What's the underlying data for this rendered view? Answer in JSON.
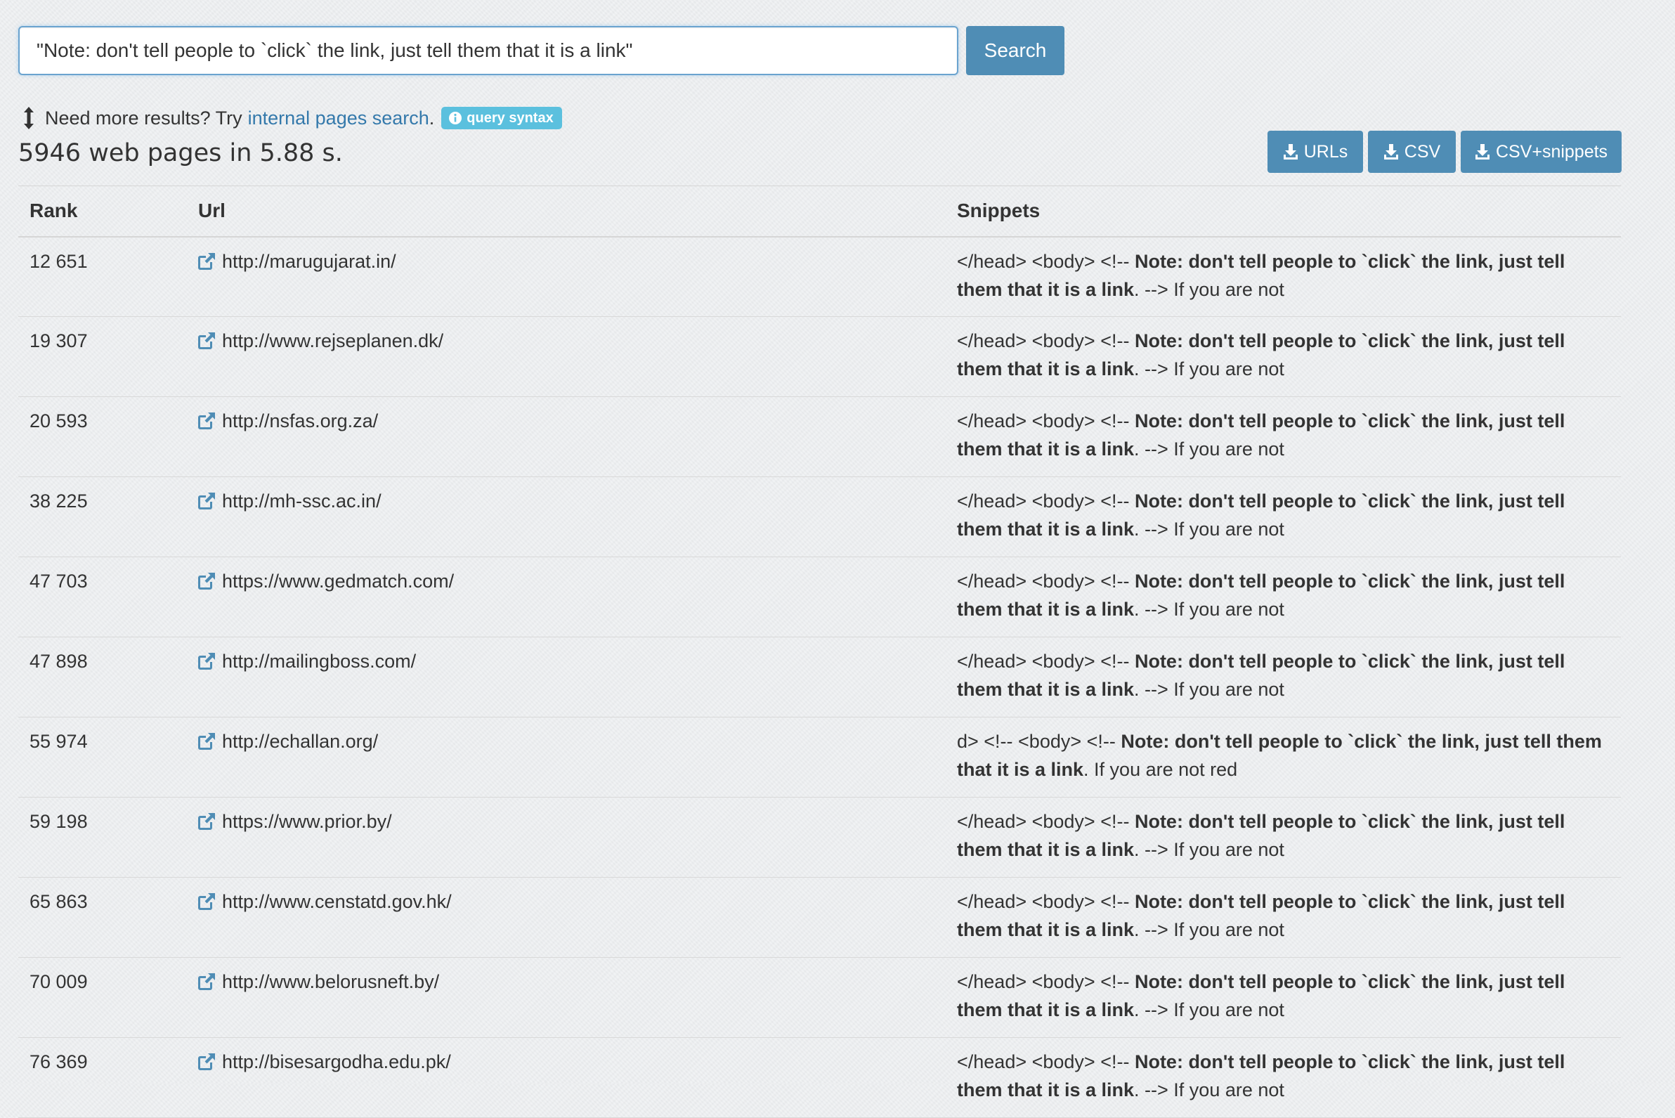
{
  "search": {
    "query": "\"Note: don't tell people to `click` the link, just tell them that it is a link\"",
    "button_label": "Search"
  },
  "hint": {
    "prefix": "Need more results? Try",
    "link_label": "internal pages search",
    "suffix": ".",
    "badge_label": "query syntax"
  },
  "results_summary": "5946 web pages in 5.88 s.",
  "downloads": {
    "urls_label": "URLs",
    "csv_label": "CSV",
    "csv_snippets_label": "CSV+snippets"
  },
  "table": {
    "headers": {
      "rank": "Rank",
      "url": "Url",
      "snippets": "Snippets"
    },
    "rows": [
      {
        "rank": "12 651",
        "url": "http://marugujarat.in/",
        "snippet_pre": "</head> <body> <!-- ",
        "snippet_bold1": "Note: don't tell people to `click` the link, just tell them that it is a link",
        "snippet_post": ". --> If you are not"
      },
      {
        "rank": "19 307",
        "url": "http://www.rejseplanen.dk/",
        "snippet_pre": "</head> <body> <!-- ",
        "snippet_bold1": "Note: don't tell people to `click` the link, just tell them that it is a link",
        "snippet_post": ". --> If you are not"
      },
      {
        "rank": "20 593",
        "url": "http://nsfas.org.za/",
        "snippet_pre": "</head> <body> <!-- ",
        "snippet_bold1": "Note: don't tell people to `click` the link, just tell them that it is a link",
        "snippet_post": ". --> If you are not"
      },
      {
        "rank": "38 225",
        "url": "http://mh-ssc.ac.in/",
        "snippet_pre": "</head> <body> <!-- ",
        "snippet_bold1": "Note: don't tell people to `click` the link, just tell them that it is a link",
        "snippet_post": ". --> If you are not"
      },
      {
        "rank": "47 703",
        "url": "https://www.gedmatch.com/",
        "snippet_pre": "</head> <body> <!-- ",
        "snippet_bold1": "Note: don't tell people to `click` the link, just tell them that it is a link",
        "snippet_post": ". --> If you are not"
      },
      {
        "rank": "47 898",
        "url": "http://mailingboss.com/",
        "snippet_pre": "</head> <body> <!-- ",
        "snippet_bold1": "Note: don't tell people to `click` the link, just tell them that it is a link",
        "snippet_post": ". --> If you are not"
      },
      {
        "rank": "55 974",
        "url": "http://echallan.org/",
        "snippet_pre": "d> <!-- <body> <!-- ",
        "snippet_bold1": "Note: don't tell people to `click` the link, just tell them that it is a link",
        "snippet_post": ". If you are not red"
      },
      {
        "rank": "59 198",
        "url": "https://www.prior.by/",
        "snippet_pre": "</head> <body> <!-- ",
        "snippet_bold1": "Note: don't tell people to `click` the link, just tell them that it is a link",
        "snippet_post": ". --> If you are not"
      },
      {
        "rank": "65 863",
        "url": "http://www.censtatd.gov.hk/",
        "snippet_pre": "</head> <body> <!-- ",
        "snippet_bold1": "Note: don't tell people to `click` the link, just tell them that it is a link",
        "snippet_post": ". --> If you are not"
      },
      {
        "rank": "70 009",
        "url": "http://www.belorusneft.by/",
        "snippet_pre": "</head> <body> <!-- ",
        "snippet_bold1": "Note: don't tell people to `click` the link, just tell them that it is a link",
        "snippet_post": ". --> If you are not"
      },
      {
        "rank": "76 369",
        "url": "http://bisesargodha.edu.pk/",
        "snippet_pre": "</head> <body> <!-- ",
        "snippet_bold1": "Note: don't tell people to `click` the link, just tell them that it is a link",
        "snippet_post": ". --> If you are not"
      }
    ]
  },
  "colors": {
    "primary_button": "#4f8db5",
    "link": "#3479ab",
    "badge": "#5bc0de",
    "focus_border": "#6aa3cf"
  },
  "icons": {
    "hint": "up-down-arrow-icon",
    "badge": "info-icon",
    "download": "download-icon",
    "url": "external-link-icon"
  }
}
